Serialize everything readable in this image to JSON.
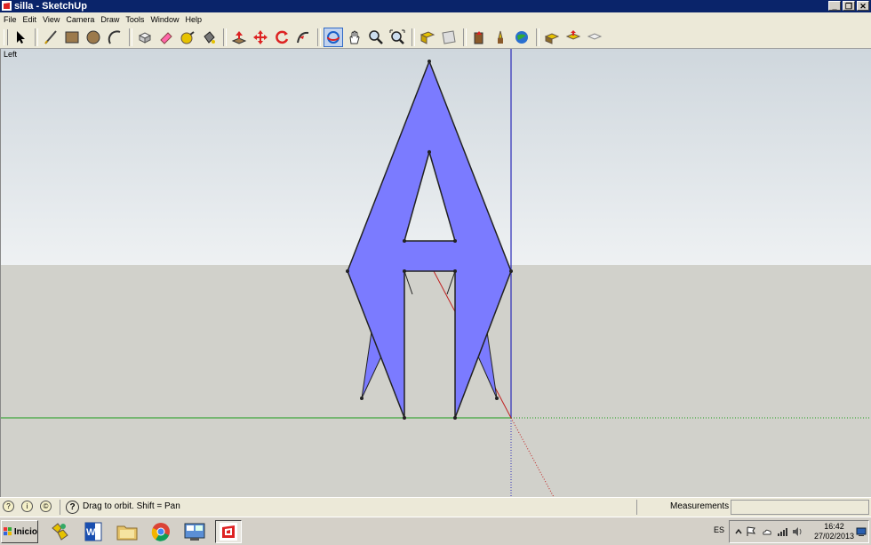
{
  "window": {
    "title": "silla - SketchUp"
  },
  "menu": {
    "items": [
      "File",
      "Edit",
      "View",
      "Camera",
      "Draw",
      "Tools",
      "Window",
      "Help"
    ]
  },
  "toolbar": {
    "tools": [
      "select-tool",
      "line-tool",
      "rectangle-tool",
      "circle-tool",
      "arc-tool",
      "make-component-tool",
      "eraser-tool",
      "tape-measure-tool",
      "paint-bucket-tool",
      "push-pull-tool",
      "move-tool",
      "rotate-tool",
      "follow-me-tool",
      "orbit-tool",
      "pan-tool",
      "zoom-tool",
      "zoom-extents-tool",
      "get-models-tool",
      "share-model-tool",
      "3d-warehouse-tool",
      "add-location-tool",
      "toggle-terrain-tool",
      "photo-textures-tool",
      "preview-in-google-earth-tool",
      "get-photo-texture-tool"
    ],
    "active_tool": "orbit-tool"
  },
  "viewport": {
    "view_label": "Left",
    "model_fill_color": "#7b7bff",
    "sky_color": "#dde3e8",
    "ground_color": "#d1d1cb"
  },
  "status": {
    "hint": "Drag to orbit.  Shift = Pan",
    "measurements_label": "Measurements",
    "measurements_value": ""
  },
  "taskbar": {
    "start_label": "Inicio",
    "apps": [
      "puzzle-icon",
      "word-icon",
      "folder-icon",
      "chrome-icon",
      "control-panel-icon",
      "sketchup-icon"
    ],
    "language": "ES",
    "time": "16:42",
    "date": "27/02/2013"
  }
}
